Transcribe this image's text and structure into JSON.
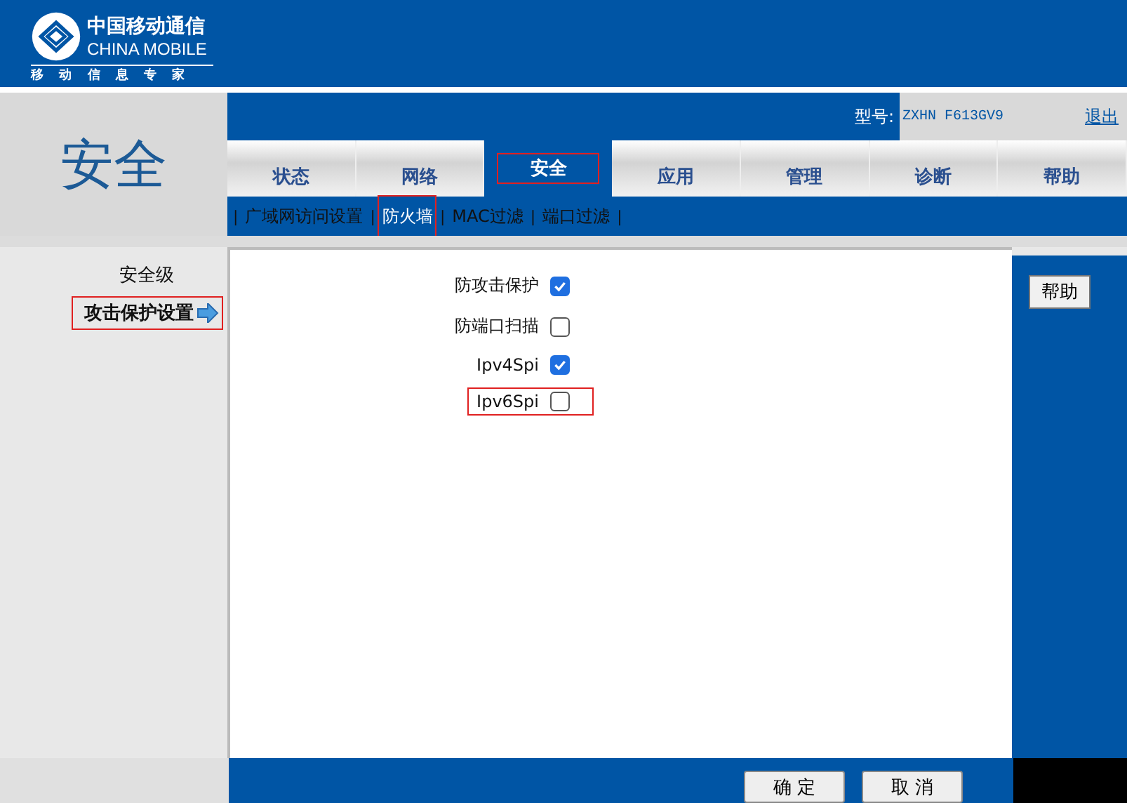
{
  "logo": {
    "title": "中国移动通信",
    "subtitle": "CHINA MOBILE",
    "slogan": "移 动 信 息 专 家"
  },
  "page_title": "安全",
  "model": {
    "label": "型号:",
    "value": "ZXHN F613GV9"
  },
  "logout": "退出",
  "tabs": [
    {
      "label": "状态",
      "selected": false
    },
    {
      "label": "网络",
      "selected": false
    },
    {
      "label": "安全",
      "selected": true
    },
    {
      "label": "应用",
      "selected": false
    },
    {
      "label": "管理",
      "selected": false
    },
    {
      "label": "诊断",
      "selected": false
    },
    {
      "label": "帮助",
      "selected": false
    }
  ],
  "subtab_separator": "|",
  "subtabs": [
    {
      "label": "广域网访问设置",
      "selected": false
    },
    {
      "label": "防火墙",
      "selected": true
    },
    {
      "label": "MAC过滤",
      "selected": false
    },
    {
      "label": "端口过滤",
      "selected": false
    }
  ],
  "sidebar": {
    "items": [
      {
        "label": "安全级",
        "selected": false
      },
      {
        "label": "攻击保护设置",
        "selected": true
      }
    ]
  },
  "options": [
    {
      "label": "防攻击保护",
      "checked": true,
      "highlighted": false
    },
    {
      "label": "防端口扫描",
      "checked": false,
      "highlighted": false
    },
    {
      "label": "Ipv4Spi",
      "checked": true,
      "highlighted": false
    },
    {
      "label": "Ipv6Spi",
      "checked": false,
      "highlighted": true
    }
  ],
  "help_button": "帮助",
  "buttons": [
    "确 定",
    "取 消"
  ]
}
